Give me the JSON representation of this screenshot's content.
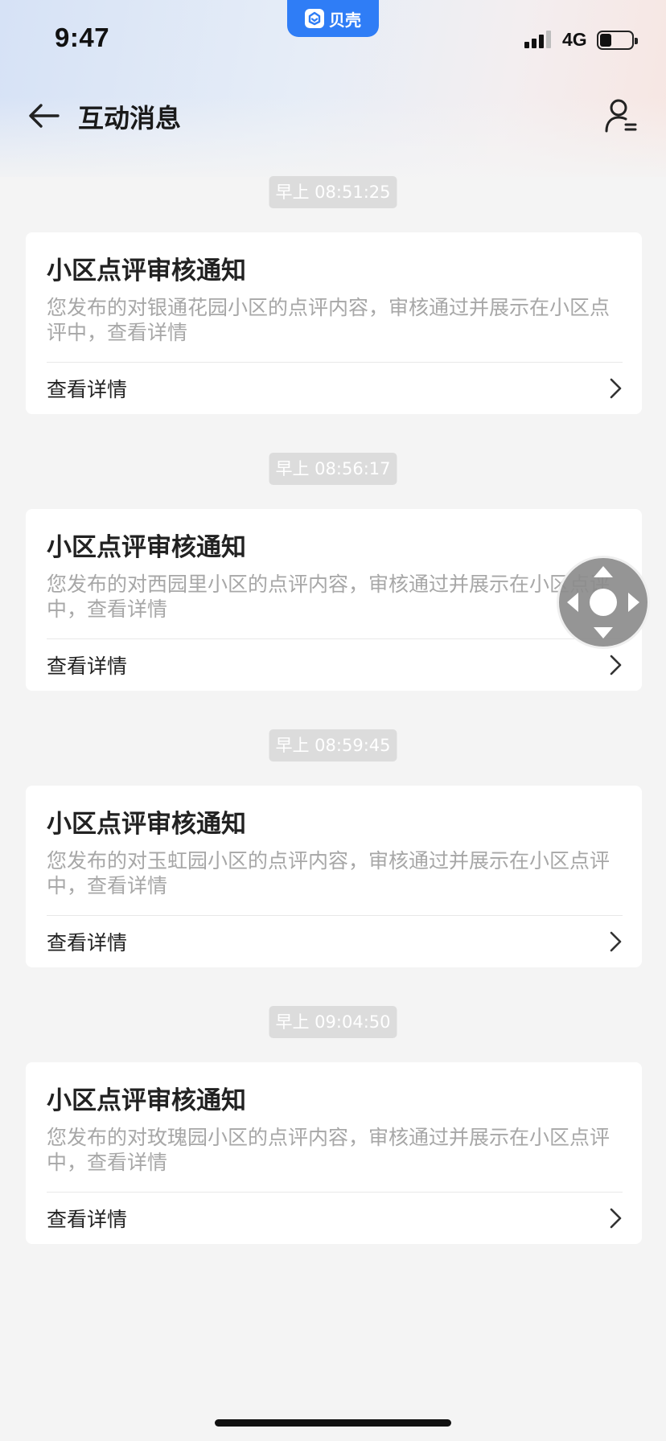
{
  "status_bar": {
    "time": "9:47",
    "app_name": "贝壳",
    "network": "4G",
    "signal_icon": "signal-bars-icon",
    "battery_icon": "battery-icon"
  },
  "nav": {
    "title": "互动消息",
    "back_icon": "arrow-left-icon",
    "user_icon": "user-menu-icon"
  },
  "messages": [
    {
      "timestamp": "早上 08:51:25",
      "title": "小区点评审核通知",
      "body": "您发布的对银通花园小区的点评内容，审核通过并展示在小区点评中，查看详情",
      "link": "查看详情"
    },
    {
      "timestamp": "早上 08:56:17",
      "title": "小区点评审核通知",
      "body": "您发布的对西园里小区的点评内容，审核通过并展示在小区点评中，查看详情",
      "link": "查看详情"
    },
    {
      "timestamp": "早上 08:59:45",
      "title": "小区点评审核通知",
      "body": "您发布的对玉虹园小区的点评内容，审核通过并展示在小区点评中，查看详情",
      "link": "查看详情"
    },
    {
      "timestamp": "早上 09:04:50",
      "title": "小区点评审核通知",
      "body": "您发布的对玫瑰园小区的点评内容，审核通过并展示在小区点评中，查看详情",
      "link": "查看详情"
    }
  ],
  "colors": {
    "accent": "#2f7df6",
    "background": "#f4f4f4",
    "body_text": "#a7a7a7",
    "timestamp_bg": "#dcdcdc"
  }
}
